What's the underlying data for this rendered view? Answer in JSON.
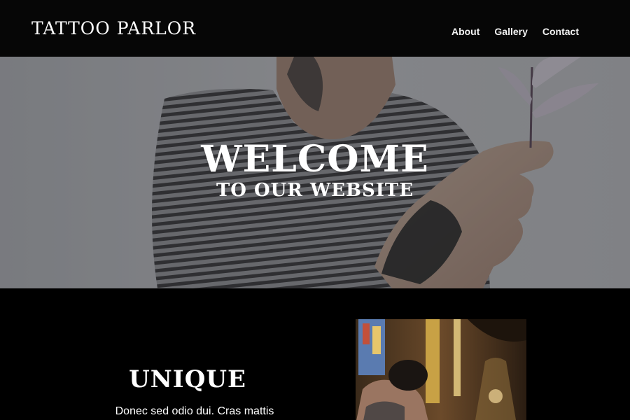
{
  "header": {
    "brand": "TATTOO PARLOR",
    "nav": [
      "About",
      "Gallery",
      "Contact"
    ]
  },
  "hero": {
    "title": "WELCOME",
    "subtitle": "TO OUR WEBSITE"
  },
  "section": {
    "heading": "UNIQUE",
    "text": "Donec sed odio dui. Cras mattis"
  },
  "colors": {
    "header_bg": "#060606",
    "page_bg": "#000000",
    "text": "#ffffff"
  }
}
